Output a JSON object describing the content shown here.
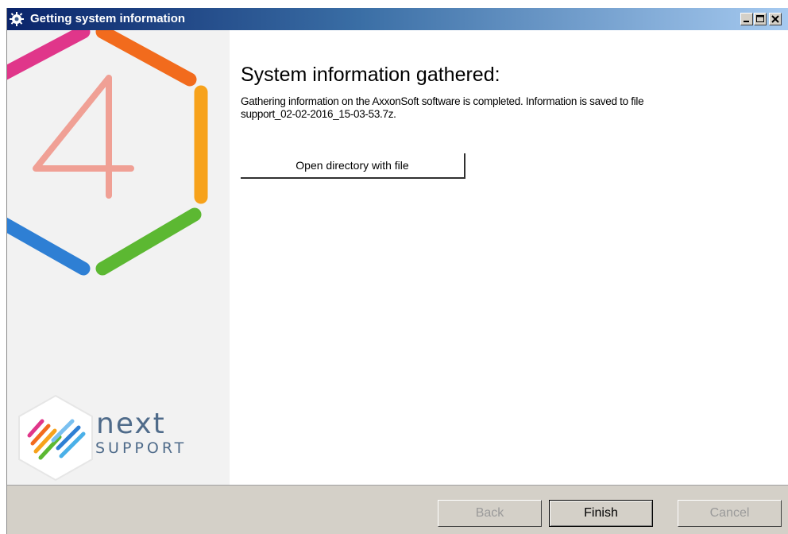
{
  "window": {
    "title": "Getting system information",
    "controls": [
      "minimize",
      "maximize",
      "close"
    ]
  },
  "sidebar": {
    "version_digit": "4",
    "brand_next": "next",
    "brand_support": "SUPPORT"
  },
  "main": {
    "heading": "System information gathered:",
    "message_line1": "Gathering information on the AxxonSoft software is completed. Information is saved to file",
    "message_line2": "support_02-02-2016_15-03-53.7z.",
    "open_button_label": "Open directory with file"
  },
  "footer": {
    "back_label": "Back",
    "finish_label": "Finish",
    "cancel_label": "Cancel"
  },
  "colors": {
    "title_gradient_start": "#0a246a",
    "title_gradient_end": "#a6caf0",
    "hex_magenta": "#e0368a",
    "hex_orange": "#f26b1d",
    "hex_yellow": "#f7a21b",
    "hex_green": "#5cb832",
    "hex_blue": "#2e7fd4",
    "digit_salmon": "#f0a095",
    "brand_text": "#4f6b8a"
  }
}
